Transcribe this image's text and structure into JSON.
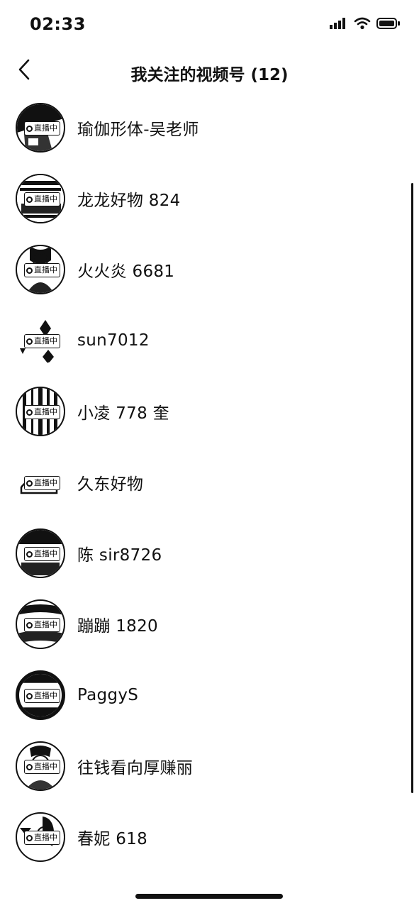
{
  "status_bar": {
    "time": "02:33",
    "icons": [
      "signal-icon",
      "wifi-icon",
      "battery-icon"
    ]
  },
  "header": {
    "title": "我关注的视频号 (12)",
    "back_icon": "chevron-left-icon"
  },
  "live_label": "直播中",
  "items": [
    {
      "name": "瑜伽形体-吴老师",
      "live": true
    },
    {
      "name": "龙龙好物 824",
      "live": true
    },
    {
      "name": "火火炎 6681",
      "live": true
    },
    {
      "name": "sun7012",
      "live": true
    },
    {
      "name": "小凌 778 奎",
      "live": true
    },
    {
      "name": "久东好物",
      "live": true
    },
    {
      "name": "陈 sir8726",
      "live": true
    },
    {
      "name": "蹦蹦 1820",
      "live": true
    },
    {
      "name": "PaggyS",
      "live": true
    },
    {
      "name": "往钱看向厚赚丽",
      "live": true
    },
    {
      "name": "春妮 618",
      "live": true
    }
  ]
}
